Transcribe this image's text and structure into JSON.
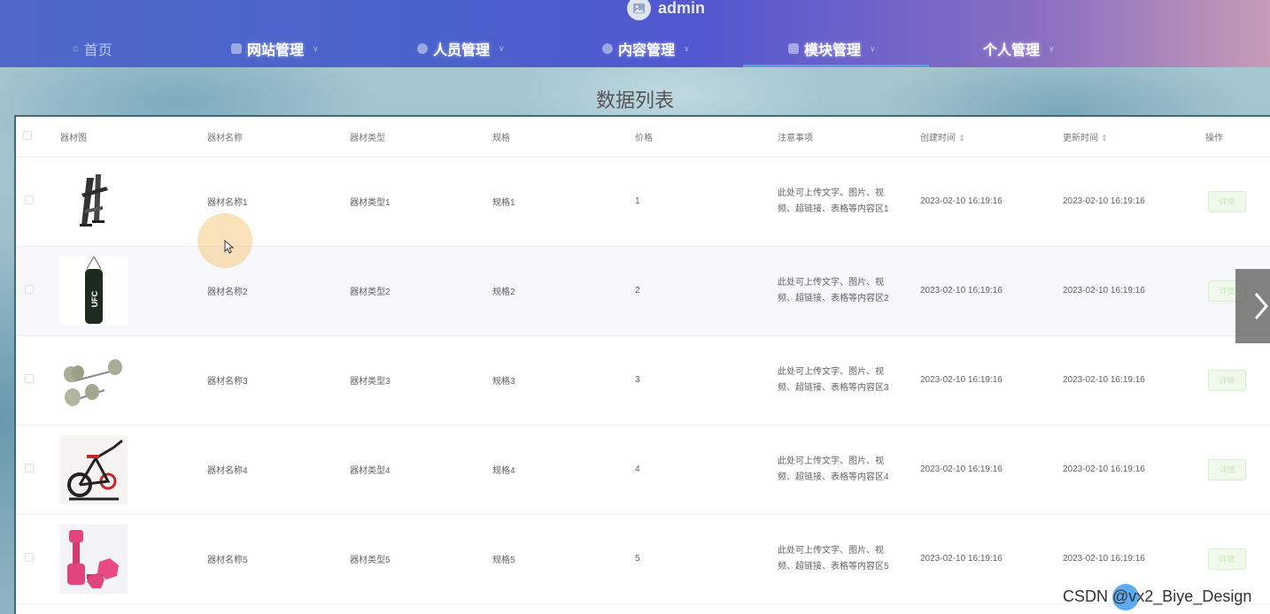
{
  "header": {
    "username": "admin",
    "nav": [
      {
        "label": "首页",
        "icon": "home-icon"
      },
      {
        "label": "网站管理",
        "icon": "monitor-icon"
      },
      {
        "label": "人员管理",
        "icon": "user-icon"
      },
      {
        "label": "内容管理",
        "icon": "content-icon"
      },
      {
        "label": "模块管理",
        "icon": "module-icon",
        "active": true
      },
      {
        "label": "个人管理",
        "icon": ""
      }
    ]
  },
  "page": {
    "title": "数据列表"
  },
  "table": {
    "columns": [
      "器材图",
      "器材名称",
      "器材类型",
      "规格",
      "价格",
      "注意事项",
      "创建时间",
      "更新时间",
      "操作"
    ],
    "rows": [
      {
        "name": "器材名称1",
        "type": "器材类型1",
        "spec": "规格1",
        "price": "1",
        "note_line1": "此处可上传文字、图片、视",
        "note_line2": "频、超链接、表格等内容区1",
        "created": "2023-02-10 16:19:16",
        "updated": "2023-02-10 16:19:16",
        "action": "详情",
        "image": "power-tower-image"
      },
      {
        "name": "器材名称2",
        "type": "器材类型2",
        "spec": "规格2",
        "price": "2",
        "note_line1": "此处可上传文字、图片、视",
        "note_line2": "频、超链接、表格等内容区2",
        "created": "2023-02-10 16:19:16",
        "updated": "2023-02-10 16:19:16",
        "action": "详情",
        "image": "punching-bag-image",
        "image_text": "UFC"
      },
      {
        "name": "器材名称3",
        "type": "器材类型3",
        "spec": "规格3",
        "price": "3",
        "note_line1": "此处可上传文字、图片、视",
        "note_line2": "频、超链接、表格等内容区3",
        "created": "2023-02-10 16:19:16",
        "updated": "2023-02-10 16:19:16",
        "action": "详情",
        "image": "dumbbells-image"
      },
      {
        "name": "器材名称4",
        "type": "器材类型4",
        "spec": "规格4",
        "price": "4",
        "note_line1": "此处可上传文字、图片、视",
        "note_line2": "频、超链接、表格等内容区4",
        "created": "2023-02-10 16:19:16",
        "updated": "2023-02-10 16:19:16",
        "action": "详情",
        "image": "spin-bike-image"
      },
      {
        "name": "器材名称5",
        "type": "器材类型5",
        "spec": "规格5",
        "price": "5",
        "note_line1": "此处可上传文字、图片、视",
        "note_line2": "频、超链接、表格等内容区5",
        "created": "2023-02-10 16:19:16",
        "updated": "2023-02-10 16:19:16",
        "action": "详情",
        "image": "pink-dumbbells-image"
      }
    ]
  },
  "watermark": "CSDN @vx2_Biye_Design",
  "colors": {
    "header_start": "#4f68c9",
    "header_end": "#c79bb7",
    "action_bg": "#f0f9eb"
  }
}
